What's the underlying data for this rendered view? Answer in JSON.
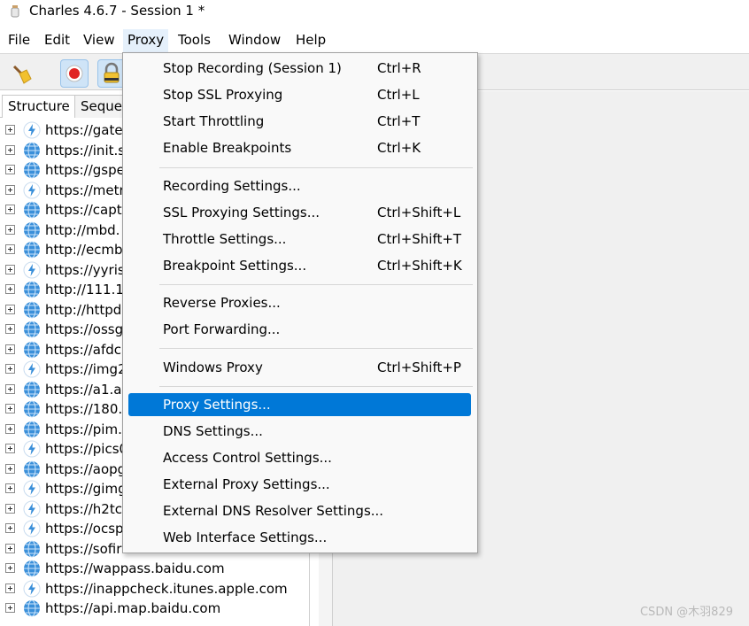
{
  "window": {
    "title": "Charles 4.6.7 - Session 1 *"
  },
  "menubar": [
    "File",
    "Edit",
    "View",
    "Proxy",
    "Tools",
    "Window",
    "Help"
  ],
  "toolbar": {
    "buttons": [
      "broom-icon",
      "record-icon",
      "ssl-lock-icon"
    ]
  },
  "tabs": [
    "Structure",
    "Seque"
  ],
  "tree": [
    {
      "host": "https://gate",
      "icon": "lightning"
    },
    {
      "host": "https://init.s",
      "icon": "globe"
    },
    {
      "host": "https://gspe",
      "icon": "globe"
    },
    {
      "host": "https://metr",
      "icon": "lightning"
    },
    {
      "host": "https://capt",
      "icon": "globe"
    },
    {
      "host": "http://mbd.",
      "icon": "globe"
    },
    {
      "host": "http://ecmb",
      "icon": "globe"
    },
    {
      "host": "https://yyris",
      "icon": "lightning"
    },
    {
      "host": "http://111.1",
      "icon": "globe"
    },
    {
      "host": "http://httpd",
      "icon": "globe"
    },
    {
      "host": "https://ossg",
      "icon": "globe"
    },
    {
      "host": "https://afdc",
      "icon": "globe"
    },
    {
      "host": "https://img2",
      "icon": "lightning"
    },
    {
      "host": "https://a1.al",
      "icon": "globe"
    },
    {
      "host": "https://180.",
      "icon": "globe"
    },
    {
      "host": "https://pim.",
      "icon": "globe"
    },
    {
      "host": "https://pics0",
      "icon": "lightning"
    },
    {
      "host": "https://aopg",
      "icon": "globe"
    },
    {
      "host": "https://gimg",
      "icon": "lightning"
    },
    {
      "host": "https://h2tc",
      "icon": "lightning"
    },
    {
      "host": "https://ocsp",
      "icon": "lightning"
    },
    {
      "host": "https://sofir",
      "icon": "globe"
    },
    {
      "host": "https://wappass.baidu.com",
      "icon": "globe"
    },
    {
      "host": "https://inappcheck.itunes.apple.com",
      "icon": "lightning"
    },
    {
      "host": "https://api.map.baidu.com",
      "icon": "globe"
    }
  ],
  "proxy_menu": {
    "groups": [
      [
        {
          "label": "Stop Recording (Session 1)",
          "shortcut": "Ctrl+R"
        },
        {
          "label": "Stop SSL Proxying",
          "shortcut": "Ctrl+L"
        },
        {
          "label": "Start Throttling",
          "shortcut": "Ctrl+T"
        },
        {
          "label": "Enable Breakpoints",
          "shortcut": "Ctrl+K"
        }
      ],
      [
        {
          "label": "Recording Settings...",
          "shortcut": ""
        },
        {
          "label": "SSL Proxying Settings...",
          "shortcut": "Ctrl+Shift+L"
        },
        {
          "label": "Throttle Settings...",
          "shortcut": "Ctrl+Shift+T"
        },
        {
          "label": "Breakpoint Settings...",
          "shortcut": "Ctrl+Shift+K"
        }
      ],
      [
        {
          "label": "Reverse Proxies...",
          "shortcut": ""
        },
        {
          "label": "Port Forwarding...",
          "shortcut": ""
        }
      ],
      [
        {
          "label": "Windows Proxy",
          "shortcut": "Ctrl+Shift+P"
        }
      ],
      [
        {
          "label": "Proxy Settings...",
          "shortcut": "",
          "highlighted": true
        },
        {
          "label": "DNS Settings...",
          "shortcut": ""
        },
        {
          "label": "Access Control Settings...",
          "shortcut": ""
        },
        {
          "label": "External Proxy Settings...",
          "shortcut": ""
        },
        {
          "label": "External DNS Resolver Settings...",
          "shortcut": ""
        },
        {
          "label": "Web Interface Settings...",
          "shortcut": ""
        }
      ]
    ]
  },
  "watermark": "CSDN @木羽829",
  "colors": {
    "highlight": "#0078d7",
    "record": "#e02424",
    "globe": "#3a8fd9",
    "lightning": "#3a8fd9"
  }
}
